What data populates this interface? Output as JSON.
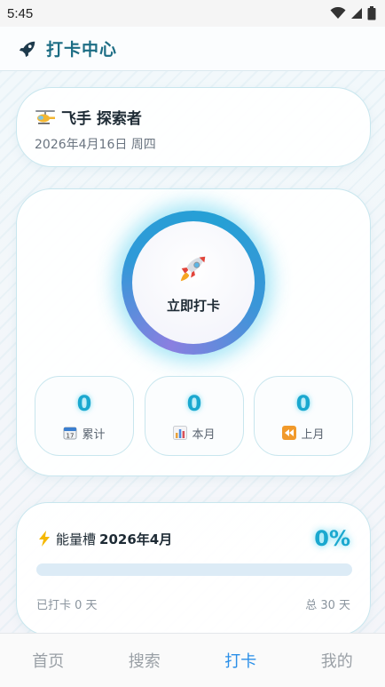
{
  "status_bar": {
    "time": "5:45"
  },
  "header": {
    "title": "打卡中心",
    "icon": "rocket-icon",
    "title_color": "#1c6d84"
  },
  "user": {
    "icon": "helicopter-icon",
    "name": "飞手 探索者",
    "date": "2026年4月16日 周四"
  },
  "checkin": {
    "icon": "rocket-icon",
    "button_label": "立即打卡",
    "stats": [
      {
        "value": "0",
        "label": "累计",
        "icon": "calendar-icon"
      },
      {
        "value": "0",
        "label": "本月",
        "icon": "bar-chart-icon"
      },
      {
        "value": "0",
        "label": "上月",
        "icon": "rewind-icon"
      }
    ]
  },
  "energy": {
    "icon": "lightning-icon",
    "title_prefix": "能量槽",
    "month": "2026年4月",
    "percent_label": "0%",
    "progress_fraction": 0,
    "checked_text": "已打卡 0 天",
    "total_text": "总 30 天"
  },
  "nav": {
    "items": [
      {
        "label": "首页",
        "active": false
      },
      {
        "label": "搜索",
        "active": false
      },
      {
        "label": "打卡",
        "active": true
      },
      {
        "label": "我的",
        "active": false
      }
    ],
    "active_color": "#2a8fe8"
  }
}
